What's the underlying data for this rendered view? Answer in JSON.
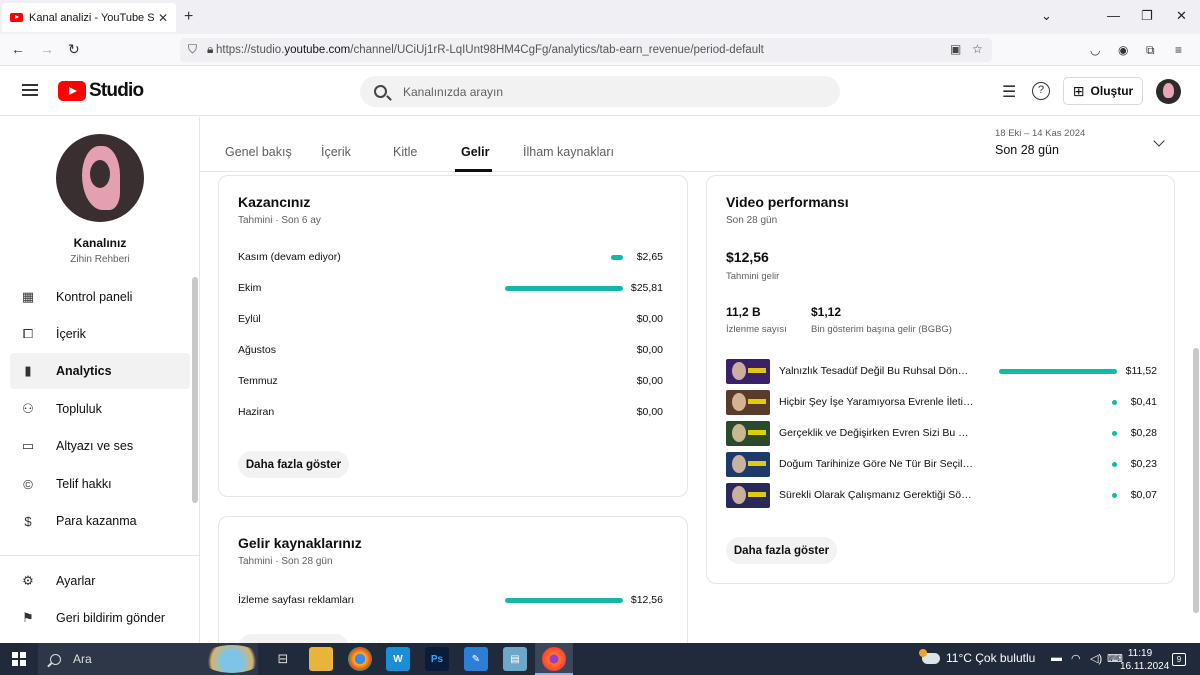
{
  "browser": {
    "tab_title": "Kanal analizi - YouTube Studio",
    "url_prefix": "https://studio.",
    "url_domain": "youtube.com",
    "url_path": "/channel/UCiUj1rR-LqIUnt98HM4CgFg/analytics/tab-earn_revenue/period-default",
    "new_tab": "+",
    "tab_close": "✕"
  },
  "header": {
    "logo_text": "Studio",
    "search_placeholder": "Kanalınızda arayın",
    "create_label": "Oluştur"
  },
  "channel": {
    "name": "Kanalınız",
    "subtitle": "Zihin Rehberi"
  },
  "sidebar": {
    "items": [
      {
        "label": "Kontrol paneli",
        "icon": "dashboard-icon"
      },
      {
        "label": "İçerik",
        "icon": "content-icon"
      },
      {
        "label": "Analytics",
        "icon": "analytics-icon"
      },
      {
        "label": "Topluluk",
        "icon": "community-icon"
      },
      {
        "label": "Altyazı ve ses",
        "icon": "subtitles-icon"
      },
      {
        "label": "Telif hakkı",
        "icon": "copyright-icon"
      },
      {
        "label": "Para kazanma",
        "icon": "dollar-icon"
      }
    ],
    "bottom": [
      {
        "label": "Ayarlar",
        "icon": "gear-icon"
      },
      {
        "label": "Geri bildirim gönder",
        "icon": "feedback-icon"
      }
    ]
  },
  "tabs": [
    "Genel bakış",
    "İçerik",
    "Kitle",
    "Gelir",
    "İlham kaynakları"
  ],
  "active_tab": "Gelir",
  "period": {
    "range": "18 Eki – 14 Kas 2024",
    "label": "Son 28 gün"
  },
  "earnings_card": {
    "title": "Kazancınız",
    "subtitle": "Tahmini · Son 6 ay",
    "rows": [
      {
        "label": "Kasım (devam ediyor)",
        "value": "$2,65",
        "amount": 2.65
      },
      {
        "label": "Ekim",
        "value": "$25,81",
        "amount": 25.81
      },
      {
        "label": "Eylül",
        "value": "$0,00",
        "amount": 0
      },
      {
        "label": "Ağustos",
        "value": "$0,00",
        "amount": 0
      },
      {
        "label": "Temmuz",
        "value": "$0,00",
        "amount": 0
      },
      {
        "label": "Haziran",
        "value": "$0,00",
        "amount": 0
      }
    ],
    "more_label": "Daha fazla göster"
  },
  "sources_card": {
    "title": "Gelir kaynaklarınız",
    "subtitle": "Tahmini · Son 28 gün",
    "rows": [
      {
        "label": "İzleme sayfası reklamları",
        "value": "$12,56",
        "amount": 12.56
      }
    ]
  },
  "video_card": {
    "title": "Video performansı",
    "subtitle": "Son 28 gün",
    "revenue_value": "$12,56",
    "revenue_label": "Tahmini gelir",
    "views_value": "11,2 B",
    "views_label": "İzlenme sayısı",
    "rpm_value": "$1,12",
    "rpm_label": "Bin gösterim başına gelir (BGBG)",
    "videos": [
      {
        "title": "Yalnızlık Tesadüf Değil Bu Ruhsal Dönüş...",
        "value": "$11,52",
        "amount": 11.52,
        "thumb_color": "#3b1f6b"
      },
      {
        "title": "Hiçbir Şey İşe Yaramıyorsa Evrenle İletişi...",
        "value": "$0,41",
        "amount": 0.41,
        "thumb_color": "#5a3a2a"
      },
      {
        "title": "Gerçeklik ve Değişirken Evren Sizi Bu Şek...",
        "value": "$0,28",
        "amount": 0.28,
        "thumb_color": "#2a4a2a"
      },
      {
        "title": "Doğum Tarihinize Göre Ne Tür Bir Seçilmi...",
        "value": "$0,23",
        "amount": 0.23,
        "thumb_color": "#1e3a6b"
      },
      {
        "title": "Sürekli Olarak Çalışmanız Gerektiği Söyle...",
        "value": "$0,07",
        "amount": 0.07,
        "thumb_color": "#2a2a5a"
      }
    ],
    "more_label": "Daha fazla göster"
  },
  "taskbar": {
    "search_label": "Ara",
    "weather": "11°C  Çok bulutlu",
    "time": "11:19",
    "date": "16.11.2024",
    "notif_count": "9",
    "weather_badge": "1"
  },
  "colors": {
    "accent_bar": "#14b8a6",
    "brand_red": "#ff0000"
  }
}
